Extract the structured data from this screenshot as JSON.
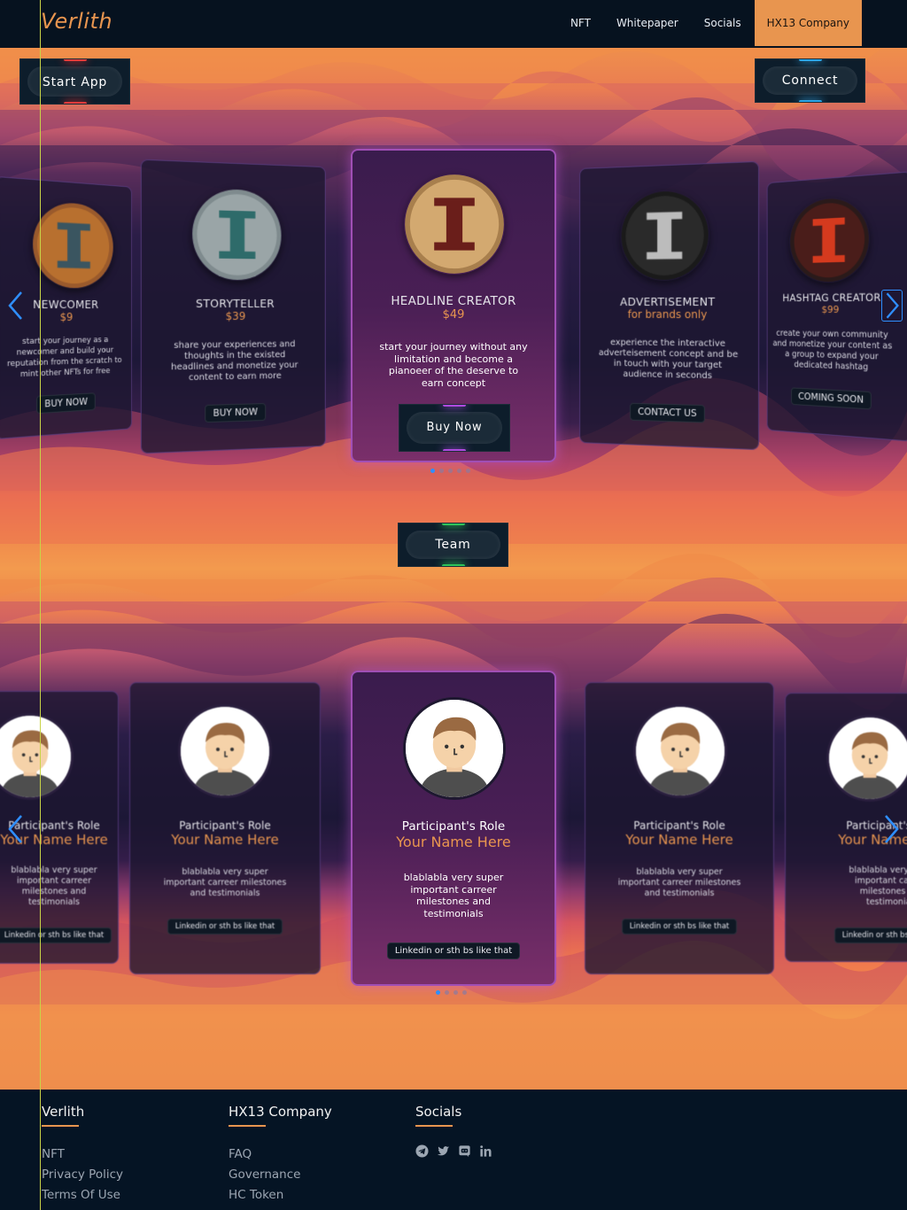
{
  "brand": "Verlith",
  "nav": {
    "items": [
      "NFT",
      "Whitepaper",
      "Socials",
      "HX13 Company"
    ],
    "active": "HX13 Company"
  },
  "hero": {
    "start_app": "Start App",
    "connect": "Connect"
  },
  "nft_cards": [
    {
      "title": "NEWCOMER",
      "price": "$9",
      "desc": "start your journey as a newcomer and build your reputation from the scratch to mint other NFTs for free",
      "button": "BUY NOW",
      "coin": "copper-coin-icon"
    },
    {
      "title": "STORYTELLER",
      "price": "$39",
      "desc": "share your experiences and thoughts in the existed headlines and monetize your content to earn more",
      "button": "BUY NOW",
      "coin": "silver-coin-icon"
    },
    {
      "title": "HEADLINE CREATOR",
      "price": "$49",
      "desc": "start your journey without any limitation and become a pianoeer of the deserve to earn concept",
      "button": "Buy Now",
      "coin": "gold-coin-icon"
    },
    {
      "title": "ADVERTISEMENT",
      "price": "for brands only",
      "desc": "experience the interactive adverteisement concept and be in touch with your target audience in seconds",
      "button": "CONTACT US",
      "coin": "black-coin-icon"
    },
    {
      "title": "HASHTAG CREATOR",
      "price": "$99",
      "desc": "create your own community and monetize your content as a group to expand your dedicated hashtag",
      "button": "COMING SOON",
      "coin": "red-coin-icon"
    }
  ],
  "team_button": "Team",
  "team_cards": [
    {
      "role": "Participant's Role",
      "name": "Your Name Here",
      "desc": "blablabla very super important carreer milestones and testimonials",
      "button": "Linkedin or sth bs like that"
    },
    {
      "role": "Participant's Role",
      "name": "Your Name Here",
      "desc": "blablabla very super important carreer milestones and testimonials",
      "button": "Linkedin or sth bs like that"
    },
    {
      "role": "Participant's Role",
      "name": "Your Name Here",
      "desc": "blablabla very super important carreer milestones and testimonials",
      "button": "Linkedin or sth bs like that"
    },
    {
      "role": "Participant's Role",
      "name": "Your Name Here",
      "desc": "blablabla very super important carreer milestones and testimonials",
      "button": "Linkedin or sth bs like that"
    },
    {
      "role": "Participant's Role",
      "name": "Your Name Here",
      "desc": "blablabla very super important carreer milestones and testimonials",
      "button": "Linkedin or sth bs like that"
    }
  ],
  "footer": {
    "col1": {
      "title": "Verlith",
      "links": [
        "NFT",
        "Privacy Policy",
        "Terms Of Use"
      ]
    },
    "col2": {
      "title": "HX13 Company",
      "links": [
        "FAQ",
        "Governance",
        "HC Token"
      ]
    },
    "col3": {
      "title": "Socials",
      "icons": [
        "telegram-icon",
        "twitter-icon",
        "discord-icon",
        "linkedin-icon"
      ]
    }
  },
  "colors": {
    "accent": "#e8954f",
    "nav_bg": "#06121f",
    "arrow": "#2f8fff"
  }
}
